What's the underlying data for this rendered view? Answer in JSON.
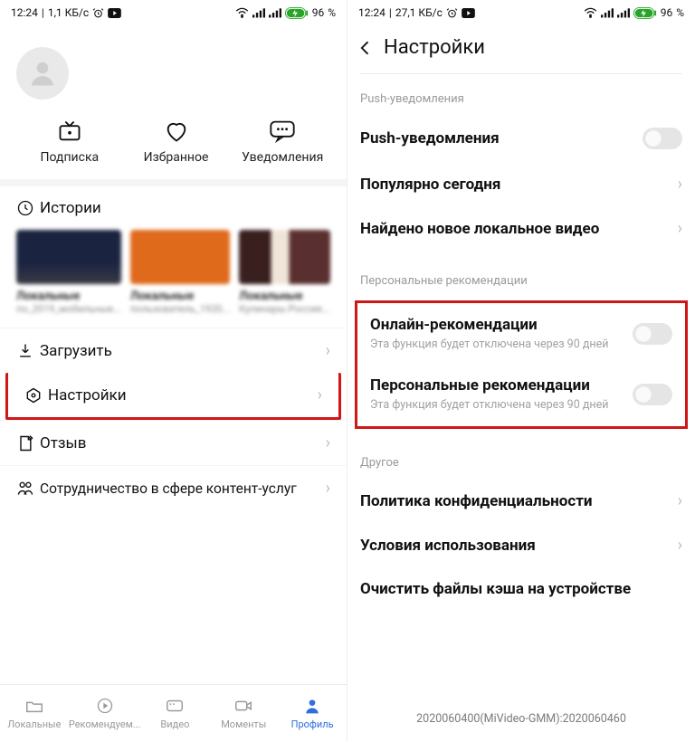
{
  "left": {
    "status": {
      "time": "12:24",
      "net": "1,1 КБ/с",
      "battery": "96"
    },
    "username": "",
    "tabs": [
      {
        "label": "Подписка"
      },
      {
        "label": "Избранное"
      },
      {
        "label": "Уведомления"
      }
    ],
    "histories_label": "Истории",
    "cards": [
      {
        "l1": "Локальные",
        "l2": "по_2019_мобильные..."
      },
      {
        "l1": "Локальные",
        "l2": "пользователь_1920..."
      },
      {
        "l1": "Локальные",
        "l2": "Кулинары.Россия..."
      }
    ],
    "items": [
      {
        "label": "Загрузить"
      },
      {
        "label": "Настройки"
      },
      {
        "label": "Отзыв"
      },
      {
        "label": "Сотрудничество в сфере контент-услуг"
      }
    ],
    "bottom": [
      {
        "label": "Локальные"
      },
      {
        "label": "Рекомендуем..."
      },
      {
        "label": "Видео"
      },
      {
        "label": "Моменты"
      },
      {
        "label": "Профиль"
      }
    ]
  },
  "right": {
    "status": {
      "time": "12:24",
      "net": "27,1 КБ/с",
      "battery": "96"
    },
    "title": "Настройки",
    "push_section": "Push-уведомления",
    "rows_push": [
      {
        "title": "Push-уведомления",
        "toggle": false
      },
      {
        "title": "Популярно сегодня"
      },
      {
        "title": "Найдено новое локальное видео"
      }
    ],
    "pers_section": "Персональные рекомендации",
    "rows_pers": [
      {
        "title": "Онлайн-рекомендации",
        "sub": "Эта функция будет отключена через 90 дней",
        "toggle": false
      },
      {
        "title": "Персональные рекомендации",
        "sub": "Эта функция будет отключена через 90 дней",
        "toggle": false
      }
    ],
    "other_section": "Другое",
    "rows_other": [
      {
        "title": "Политика конфиденциальности"
      },
      {
        "title": "Условия использования"
      },
      {
        "title": "Очистить файлы кэша на устройстве"
      }
    ],
    "build": "2020060400(MiVideo-GMM):2020060460"
  },
  "pct_suffix": " %"
}
